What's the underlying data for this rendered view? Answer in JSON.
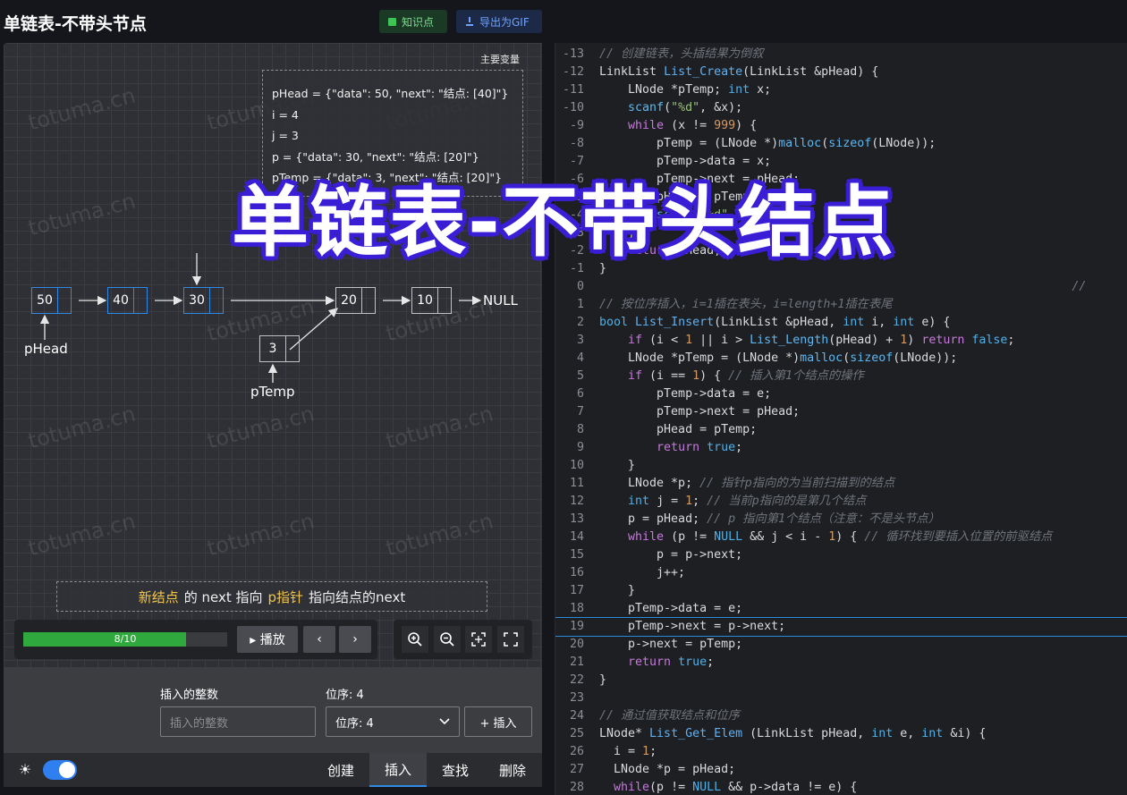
{
  "app": {
    "title": "单链表-不带头节点"
  },
  "header": {
    "knowledge_label": "知识点",
    "export_label": "导出为GIF"
  },
  "watermark": "totuma.cn",
  "vars": {
    "title": "主要变量",
    "lines": [
      "pHead = {\"data\": 50, \"next\": \"结点: [40]\"}",
      "i = 4",
      "j = 3",
      "p = {\"data\": 30, \"next\": \"结点: [20]\"}",
      "pTemp = {\"data\": 3, \"next\": \"结点: [20]\"}"
    ]
  },
  "list": {
    "nodes": [
      "50",
      "40",
      "30",
      "20",
      "10"
    ],
    "null_label": "NULL",
    "new_node": "3",
    "labels": {
      "phead": "pHead",
      "ptemp": "pTemp"
    }
  },
  "caption": {
    "part1": "新结点",
    "part2": "的 next 指向",
    "part3": "p指针",
    "part4": "指向结点的next"
  },
  "controls": {
    "progress_text": "8/10",
    "progress": 0.8,
    "play_label": "▸ 播放",
    "prev": "‹",
    "next": "›"
  },
  "form": {
    "int_label": "插入的整数",
    "int_placeholder": "插入的整数",
    "pos_label": "位序: 4",
    "pos_value": "位序: 4",
    "insert_label": "+ 插入"
  },
  "tabs": [
    "创建",
    "插入",
    "查找",
    "删除"
  ],
  "active_tab": "插入",
  "overlay_title": "单链表-不带头结点",
  "code": {
    "highlight_line": "19",
    "lines": [
      {
        "n": "-13",
        "html": "<span class='c'>// 创建链表，头插结果为倒叙</span>"
      },
      {
        "n": "-12",
        "html": "LinkList <span class='fn'>List_Create</span>(LinkList &amp;pHead) {"
      },
      {
        "n": "-11",
        "html": "    LNode *pTemp; <span class='t'>int</span> x;"
      },
      {
        "n": "-10",
        "html": "    <span class='f'>scanf</span>(<span class='s'>\"%d\"</span>, &amp;x);"
      },
      {
        "n": "-9",
        "html": "    <span class='k'>while</span> (x != <span class='n'>999</span>) {"
      },
      {
        "n": "-8",
        "html": "        pTemp = (LNode *)<span class='f'>malloc</span>(<span class='f'>sizeof</span>(LNode));"
      },
      {
        "n": "-7",
        "html": "        pTemp-&gt;data = x;"
      },
      {
        "n": "-6",
        "html": "        pTemp-&gt;next = pHead;"
      },
      {
        "n": "-5",
        "html": "        pHead = pTemp;"
      },
      {
        "n": "-4",
        "html": "        <span class='f'>scanf</span>(<span class='s'>\"%d\"</span>, &amp;x);"
      },
      {
        "n": "-3",
        "html": "    }"
      },
      {
        "n": "-2",
        "html": "    <span class='k'>return</span> pHead;"
      },
      {
        "n": "-1",
        "html": "}"
      },
      {
        "n": "0",
        "html": "                                                                  <span class='c'>//</span>"
      },
      {
        "n": "1",
        "html": "<span class='c'>// 按位序插入，i=1插在表头，i=length+1插在表尾</span>"
      },
      {
        "n": "2",
        "html": "<span class='t'>bool</span> <span class='fn'>List_Insert</span>(LinkList &amp;pHead, <span class='t'>int</span> i, <span class='t'>int</span> e) {"
      },
      {
        "n": "3",
        "html": "    <span class='k'>if</span> (i &lt; <span class='n'>1</span> || i &gt; <span class='f'>List_Length</span>(pHead) + <span class='n'>1</span>) <span class='k'>return</span> <span class='t'>false</span>;"
      },
      {
        "n": "4",
        "html": "    LNode *pTemp = (LNode *)<span class='f'>malloc</span>(<span class='f'>sizeof</span>(LNode));"
      },
      {
        "n": "5",
        "html": "    <span class='k'>if</span> (i == <span class='n'>1</span>) { <span class='c'>// 插入第1个结点的操作</span>"
      },
      {
        "n": "6",
        "html": "        pTemp-&gt;data = e;"
      },
      {
        "n": "7",
        "html": "        pTemp-&gt;next = pHead;"
      },
      {
        "n": "8",
        "html": "        pHead = pTemp;"
      },
      {
        "n": "9",
        "html": "        <span class='k'>return</span> <span class='t'>true</span>;"
      },
      {
        "n": "10",
        "html": "    }"
      },
      {
        "n": "11",
        "html": "    LNode *p; <span class='c'>// 指针p指向的为当前扫描到的结点</span>"
      },
      {
        "n": "12",
        "html": "    <span class='t'>int</span> j = <span class='n'>1</span>; <span class='c'>// 当前p指向的是第几个结点</span>"
      },
      {
        "n": "13",
        "html": "    p = pHead; <span class='c'>// p 指向第1个结点（注意：不是头节点）</span>"
      },
      {
        "n": "14",
        "html": "    <span class='k'>while</span> (p != <span class='t'>NULL</span> &amp;&amp; j &lt; i - <span class='n'>1</span>) { <span class='c'>// 循环找到要插入位置的前驱结点</span>"
      },
      {
        "n": "15",
        "html": "        p = p-&gt;next;"
      },
      {
        "n": "16",
        "html": "        j++;"
      },
      {
        "n": "17",
        "html": "    }"
      },
      {
        "n": "18",
        "html": "    pTemp-&gt;data = e;"
      },
      {
        "n": "19",
        "html": "    pTemp-&gt;next = p-&gt;next;"
      },
      {
        "n": "20",
        "html": "    p-&gt;next = pTemp;"
      },
      {
        "n": "21",
        "html": "    <span class='k'>return</span> <span class='t'>true</span>;"
      },
      {
        "n": "22",
        "html": "}"
      },
      {
        "n": "23",
        "html": ""
      },
      {
        "n": "24",
        "html": "<span class='c'>// 通过值获取结点和位序</span>"
      },
      {
        "n": "25",
        "html": "LNode* <span class='fn'>List_Get_Elem</span> (LinkList pHead, <span class='t'>int</span> e, <span class='t'>int</span> &amp;i) {"
      },
      {
        "n": "26",
        "html": "  i = <span class='n'>1</span>;"
      },
      {
        "n": "27",
        "html": "  LNode *p = pHead;"
      },
      {
        "n": "28",
        "html": "  <span class='k'>while</span>(p != <span class='t'>NULL</span> &amp;&amp; p-&gt;data != e) {"
      }
    ]
  }
}
